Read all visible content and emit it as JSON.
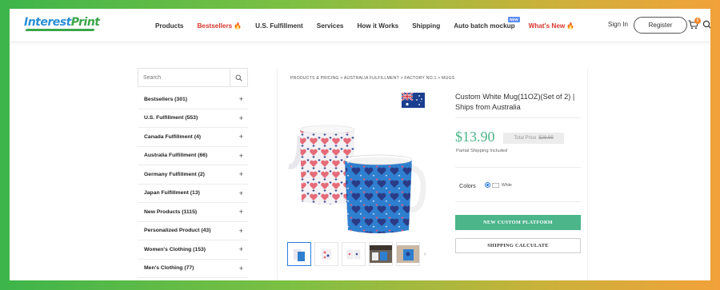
{
  "brand": {
    "part1": "Interest",
    "part2": "Print"
  },
  "nav": {
    "items": [
      {
        "label": "Products",
        "style": "normal"
      },
      {
        "label": "Bestsellers",
        "style": "red-fire"
      },
      {
        "label": "U.S. Fulfillment",
        "style": "normal"
      },
      {
        "label": "Services",
        "style": "normal"
      },
      {
        "label": "How it Works",
        "style": "normal"
      },
      {
        "label": "Shipping",
        "style": "normal"
      },
      {
        "label": "Auto batch mockup",
        "style": "new-badge"
      },
      {
        "label": "What's New",
        "style": "red-fire"
      }
    ],
    "new_badge": "NEW",
    "sign_in": "Sign In",
    "register": "Register",
    "cart_count": "0"
  },
  "sidebar": {
    "search_placeholder": "Search",
    "categories": [
      {
        "label": "Bestsellers (301)"
      },
      {
        "label": "U.S. Fulfillment (553)"
      },
      {
        "label": "Canada Fulfillment (4)"
      },
      {
        "label": "Australia Fulfillment (66)"
      },
      {
        "label": "Germany Fulfillment (2)"
      },
      {
        "label": "Japan Fulfillment (13)"
      },
      {
        "label": "New Products (1115)"
      },
      {
        "label": "Personalized Product (43)"
      },
      {
        "label": "Women's Clothing (153)"
      },
      {
        "label": "Men's Clothing (77)"
      }
    ],
    "plus": "+"
  },
  "product": {
    "breadcrumb": "PRODUCTS & PRICING > AUSTRALIA FULFILLMENT > FACTORY NO.1 > MUGS",
    "title": "Custom White Mug(11OZ)(Set of 2) | Ships from Australia",
    "price": "$13.90",
    "total_price_label": "Total Price",
    "total_price_value": "$28.99",
    "shipping_note": "Partial Shipping Included",
    "colors_label": "Colors",
    "color_selected": "White",
    "btn_platform": "NEW CUSTOM PLATFORM",
    "btn_shipping": "SHIPPING CALCULATE",
    "thumbnails_count": 5,
    "thumb_arrow": "›"
  },
  "colors": {
    "accent_green": "#4cb58a",
    "brand_blue": "#2a8fd6",
    "nav_red": "#d9342b",
    "mug_blue": "#2f7fd0"
  },
  "icons": [
    "search-icon",
    "cart-icon",
    "australia-flag-icon",
    "fire-icon",
    "plus-icon"
  ]
}
